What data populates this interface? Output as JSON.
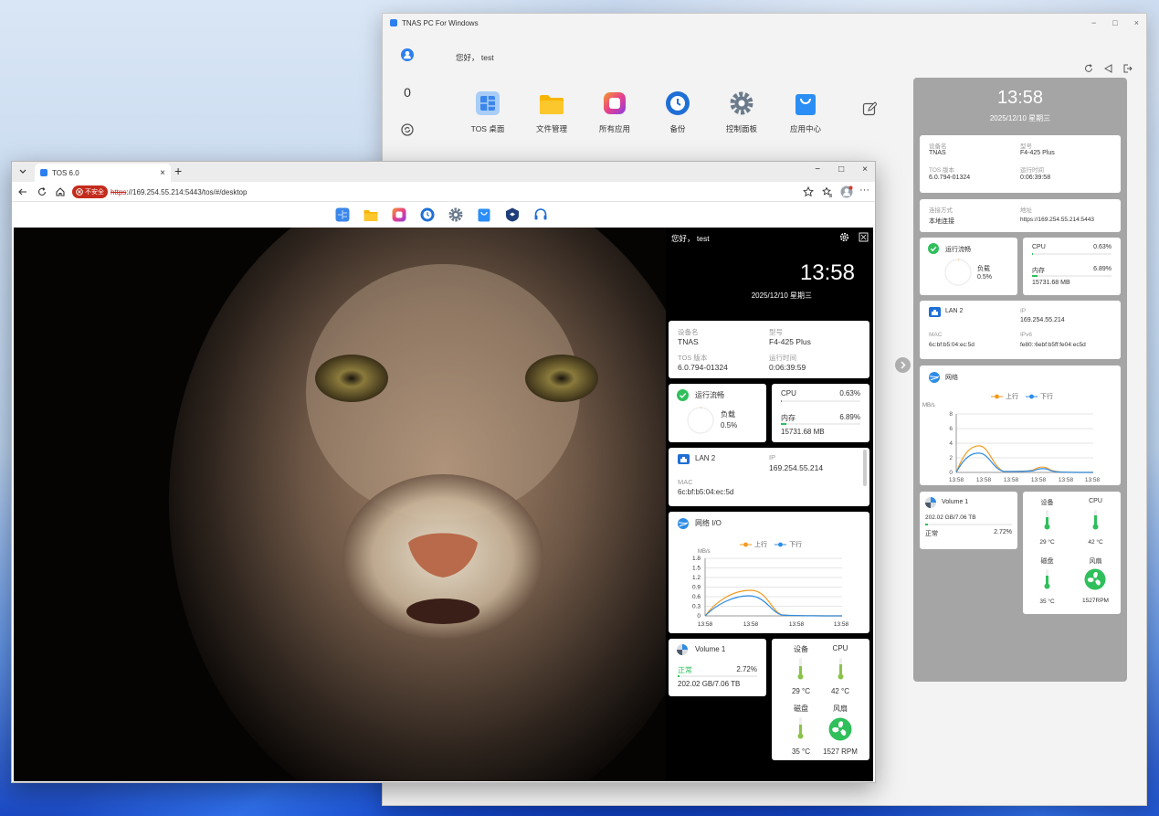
{
  "tnas_window": {
    "title": "TNAS PC For Windows",
    "controls": {
      "min": "−",
      "max": "□",
      "close": "×"
    },
    "sidebar": {
      "count": "0"
    },
    "greeting": "您好， test",
    "apps": [
      {
        "label": "TOS 桌面",
        "color": "#4a8ef0"
      },
      {
        "label": "文件管理",
        "color": "#f7b500"
      },
      {
        "label": "所有应用",
        "color": "#e8408a"
      },
      {
        "label": "备份",
        "color": "#1f6fd6"
      },
      {
        "label": "控制面板",
        "color": "#6b7b8c"
      },
      {
        "label": "应用中心",
        "color": "#2b8ef5"
      }
    ],
    "panel": {
      "time": "13:58",
      "date": "2025/12/10 星期三",
      "device": {
        "name_label": "设备名",
        "name": "TNAS",
        "model_label": "型号",
        "model": "F4-425 Plus",
        "tos_label": "TOS 版本",
        "tos": "6.0.794-01324",
        "uptime_label": "运行时间",
        "uptime": "0:06:39:58"
      },
      "conn": {
        "mode_label": "连接方式",
        "mode": "本地连接",
        "addr_label": "地址",
        "addr": "https://169.254.55.214:5443"
      },
      "status": {
        "title": "运行流畅",
        "load_label": "负载",
        "load": "0.5%",
        "cpu_label": "CPU",
        "cpu": "0.63%",
        "mem_label": "内存",
        "mem": "6.89%",
        "mem_total": "15731.68 MB",
        "cpu_fraction": 0.0063,
        "mem_fraction": 0.0689
      },
      "lan": {
        "title": "LAN 2",
        "ip_label": "IP",
        "ip": "169.254.55.214",
        "mac_label": "MAC",
        "mac": "6c:bf:b5:04:ec:5d",
        "ipv6_label": "IPv6",
        "ipv6": "fe80::6ebf:b5ff:fe04:ec5d"
      },
      "net": {
        "title": "网络",
        "up": "上行",
        "down": "下行",
        "unit": "MB/s",
        "yticks": [
          "8",
          "6",
          "4",
          "2",
          "0"
        ],
        "xticks": [
          "13:58",
          "13:58",
          "13:58",
          "13:58",
          "13:58",
          "13:58"
        ]
      },
      "volume": {
        "title": "Volume 1",
        "usage": "202.02 GB/7.06 TB",
        "state": "正常",
        "pct": "2.72%",
        "fraction": 0.0272
      },
      "temps": {
        "device_label": "设备",
        "device": "29 °C",
        "cpu_label": "CPU",
        "cpu": "42 °C",
        "disk_label": "磁盘",
        "disk": "35 °C",
        "fan_label": "风扇",
        "fan": "1527RPM"
      }
    }
  },
  "browser": {
    "tab_title": "TOS 6.0",
    "insecure": "不安全",
    "url_scheme": "https",
    "url_rest": "://169.254.55.214:5443/tos/#/desktop",
    "controls": {
      "min": "−",
      "max": "□",
      "close": "×"
    },
    "dock_icons": [
      "tos-desktop",
      "files",
      "all-apps",
      "backup",
      "control-panel",
      "app-center",
      "security",
      "support"
    ],
    "widget": {
      "greeting": "您好，  test",
      "time": "13:58",
      "date": "2025/12/10 星期三",
      "device": {
        "name_label": "设备名",
        "name": "TNAS",
        "model_label": "型号",
        "model": "F4-425 Plus",
        "tos_label": "TOS 版本",
        "tos": "6.0.794-01324",
        "uptime_label": "运行时间",
        "uptime": "0:06:39:59"
      },
      "status": {
        "title": "运行流畅",
        "load_label": "负载",
        "load": "0.5%",
        "cpu_label": "CPU",
        "cpu": "0.63%",
        "mem_label": "内存",
        "mem": "6.89%",
        "mem_total": "15731.68 MB",
        "cpu_fraction": 0.0063,
        "mem_fraction": 0.0689
      },
      "lan": {
        "title": "LAN 2",
        "ip_label": "IP",
        "ip": "169.254.55.214",
        "mac_label": "MAC",
        "mac": "6c:bf:b5:04:ec:5d"
      },
      "net": {
        "title": "网络 I/O",
        "up": "上行",
        "down": "下行",
        "unit": "MB/s",
        "yticks": [
          "1.8",
          "1.5",
          "1.2",
          "0.9",
          "0.6",
          "0.3",
          "0"
        ],
        "xticks": [
          "13:58",
          "13:58",
          "13:58",
          "13:58"
        ]
      },
      "volume": {
        "title": "Volume 1",
        "state": "正常",
        "pct": "2.72%",
        "usage": "202.02 GB/7.06 TB",
        "fraction": 0.0272
      },
      "temps": {
        "device_label": "设备",
        "device": "29 °C",
        "cpu_label": "CPU",
        "cpu": "42 °C",
        "disk_label": "磁盘",
        "disk": "35 °C",
        "fan_label": "风扇",
        "fan": "1527 RPM"
      }
    }
  },
  "colors": {
    "up": "#f39a1e",
    "down": "#2e8ce6",
    "ok": "#2fbf5b",
    "fan": "#2fbf5b"
  }
}
